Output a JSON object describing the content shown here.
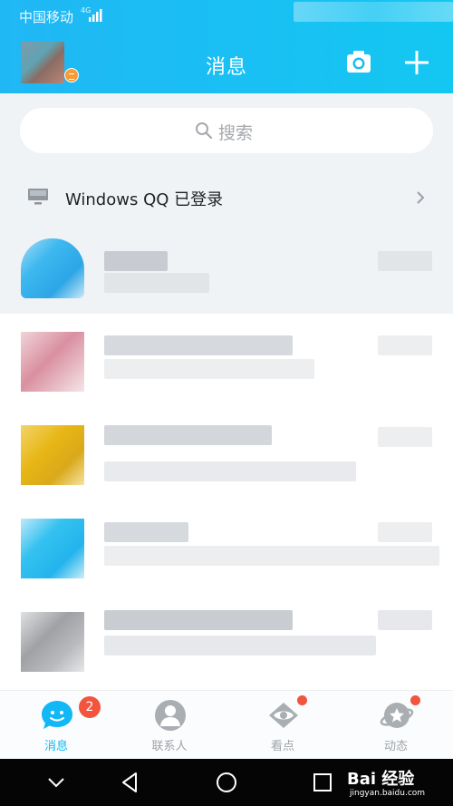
{
  "status_bar": {
    "carrier": "中国移动",
    "network": "4G"
  },
  "header": {
    "title": "消息",
    "camera_icon": "camera-icon",
    "plus_icon": "plus-icon"
  },
  "search": {
    "placeholder": "搜索"
  },
  "login_notice": {
    "text": "Windows QQ 已登录",
    "icon": "computer-icon"
  },
  "tab_bar": {
    "tabs": [
      {
        "label": "消息",
        "icon": "message-icon",
        "badge": "2",
        "active": true
      },
      {
        "label": "联系人",
        "icon": "contacts-icon"
      },
      {
        "label": "看点",
        "icon": "eye-icon",
        "dot": true
      },
      {
        "label": "动态",
        "icon": "planet-icon",
        "dot": true
      }
    ]
  },
  "nav_bar": {
    "buttons": [
      "collapse-icon",
      "back-icon",
      "home-icon",
      "recents-icon"
    ]
  },
  "watermark": {
    "text": "Bai 经验",
    "sub": "jingyan.baidu.com"
  },
  "colors": {
    "accent": "#12b7f5",
    "header_start": "#20b7f5",
    "header_end": "#14c7f2",
    "badge": "#f2543e"
  }
}
